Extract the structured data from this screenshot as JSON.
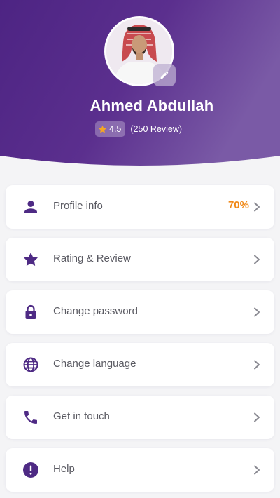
{
  "profile": {
    "name": "Ahmed Abdullah",
    "rating": "4.5",
    "reviews": "(250 Review)"
  },
  "menu": [
    {
      "label": "Profile info",
      "badge": "70%",
      "icon": "person-icon"
    },
    {
      "label": "Rating & Review",
      "icon": "star-icon"
    },
    {
      "label": "Change password",
      "icon": "lock-icon"
    },
    {
      "label": "Change language",
      "icon": "globe-icon"
    },
    {
      "label": "Get in touch",
      "icon": "phone-icon"
    },
    {
      "label": "Help",
      "icon": "exclamation-icon"
    }
  ],
  "colors": {
    "header_purple": "#5a2d8c",
    "icon_purple": "#4e2a84",
    "accent_orange": "#f08a1a",
    "star_orange": "#f5a623"
  }
}
